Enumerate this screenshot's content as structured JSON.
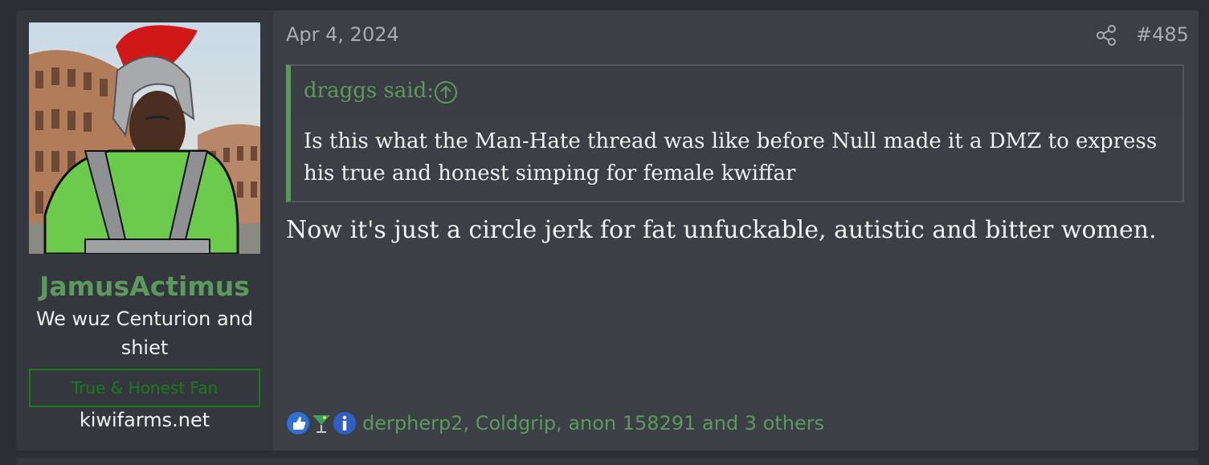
{
  "post": {
    "date": "Apr 4, 2024",
    "number": "#485",
    "user": {
      "username": "JamusActimus",
      "title": "We wuz Centurion and shiet",
      "banner": "True & Honest Fan",
      "site": "kiwifarms.net"
    },
    "quote": {
      "author": "draggs said:",
      "text": "Is this what the Man-Hate thread was like before Null made it a DMZ to express his true and honest simping for female kwiffar"
    },
    "message": "Now it's just a circle jerk for fat unfuckable, autistic and bitter women.",
    "reactions": {
      "icons": [
        "thumbs-up-icon",
        "cocktail-icon",
        "info-icon"
      ],
      "users": "derpherp2, Coldgrip, anon 158291 and 3 others"
    }
  },
  "colors": {
    "accent": "#5b9a5c",
    "banner": "#1a7a1a",
    "panel": "#3c3f46",
    "user_panel": "#34373d"
  }
}
